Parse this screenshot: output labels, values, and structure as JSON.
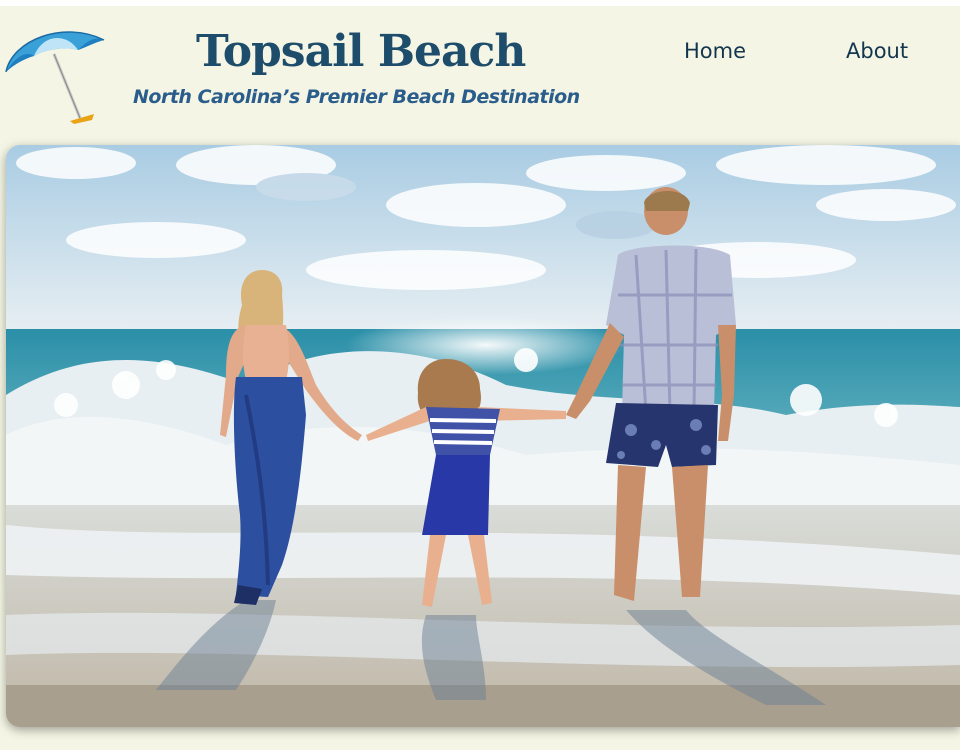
{
  "header": {
    "title": "Topsail Beach",
    "tagline": "North Carolina’s Premier Beach Destination",
    "logo_icon": "beach-umbrella-icon"
  },
  "nav": {
    "items": [
      {
        "label": "Home"
      },
      {
        "label": "About"
      }
    ]
  },
  "hero": {
    "image": "family-holding-hands-at-beach-photo"
  },
  "colors": {
    "page_background": "#f4f5e4",
    "title": "#1e4d6b",
    "tagline": "#2a5d8c",
    "nav_text": "#13364f"
  }
}
